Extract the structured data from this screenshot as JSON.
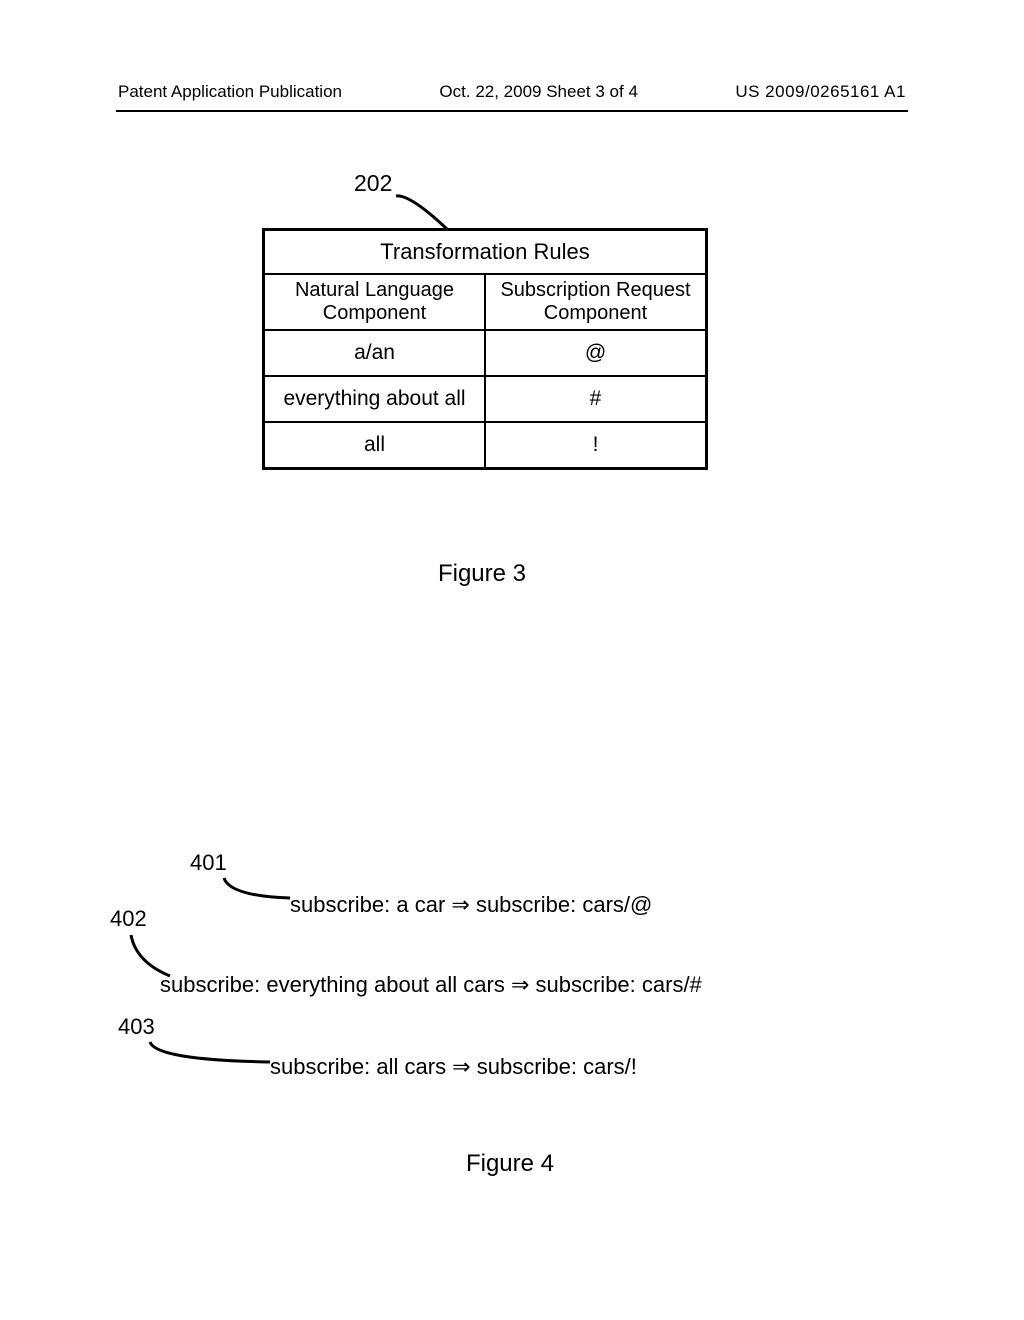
{
  "header": {
    "left": "Patent Application Publication",
    "mid": "Oct. 22, 2009  Sheet 3 of 4",
    "right": "US 2009/0265161 A1"
  },
  "figure3": {
    "ref": "202",
    "title": "Transformation Rules",
    "col1_header_line1": "Natural Language",
    "col1_header_line2": "Component",
    "col2_header_line1": "Subscription Request",
    "col2_header_line2": "Component",
    "rows": [
      {
        "nl": "a/an",
        "sr": "@"
      },
      {
        "nl": "everything about all",
        "sr": "#"
      },
      {
        "nl": "all",
        "sr": "!"
      }
    ],
    "caption": "Figure 3"
  },
  "figure4": {
    "refs": {
      "r1": "401",
      "r2": "402",
      "r3": "403"
    },
    "line1": "subscribe: a car  ⇒  subscribe: cars/@",
    "line2": "subscribe: everything about all cars  ⇒  subscribe: cars/#",
    "line3": "subscribe: all cars  ⇒  subscribe: cars/!",
    "caption": "Figure 4"
  }
}
